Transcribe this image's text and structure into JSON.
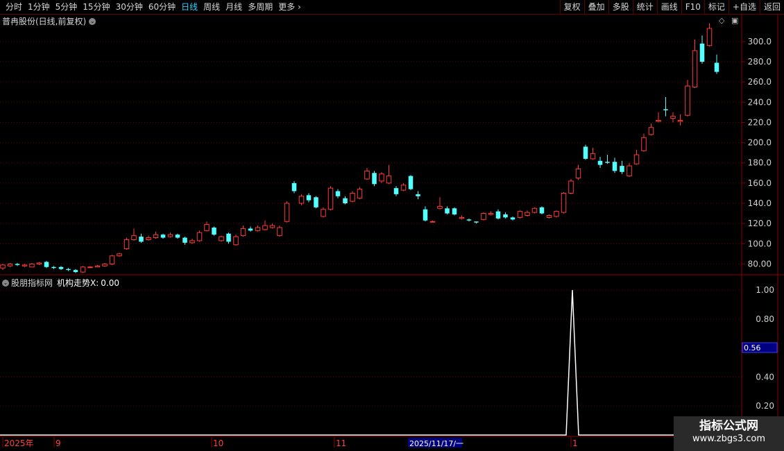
{
  "toolbar": {
    "left_items": [
      "分时",
      "1分钟",
      "5分钟",
      "15分钟",
      "30分钟",
      "60分钟",
      "日线",
      "周线",
      "月线",
      "多周期",
      "更多"
    ],
    "active": "日线",
    "right_items": [
      "复权",
      "叠加",
      "多股",
      "统计",
      "画线",
      "F10",
      "标记",
      "+自选",
      "返回"
    ]
  },
  "chart": {
    "title": "普冉股份(日线,前复权)",
    "price_axis": [
      "300.0",
      "280.0",
      "260.0",
      "240.0",
      "220.0",
      "200.0",
      "180.0",
      "160.0",
      "140.0",
      "120.0",
      "100.0",
      "80.00"
    ],
    "colors": {
      "up": "#ff3b3b",
      "down": "#54ffff",
      "grid": "#6e0000",
      "frame": "#8a0000"
    }
  },
  "indicator": {
    "source": "股朋指标网",
    "name": "机构走势X:",
    "value": "0.00",
    "axis": [
      "1.00",
      "0.80",
      "0.40",
      "0.20"
    ],
    "cursor_value": "0.56"
  },
  "time_axis": {
    "labels": [
      "2025年",
      "9",
      "10",
      "11",
      "1"
    ],
    "cursor_date": "2025/11/17/一"
  },
  "watermark": {
    "line1": "指标公式网",
    "line2": "www.zbgs3.com"
  },
  "chart_data": {
    "type": "candlestick",
    "ylim": [
      70,
      315
    ],
    "indicator_ylim": [
      0,
      1
    ],
    "candles": [
      [
        76,
        79,
        74,
        80
      ],
      [
        78,
        80,
        77,
        81
      ],
      [
        80,
        79,
        78,
        81
      ],
      [
        78,
        79,
        77,
        80
      ],
      [
        77,
        80,
        77,
        81
      ],
      [
        80,
        81,
        79,
        82
      ],
      [
        82,
        77,
        76,
        83
      ],
      [
        77,
        76,
        75,
        78
      ],
      [
        77,
        75,
        74,
        78
      ],
      [
        75,
        74,
        73,
        76
      ],
      [
        74,
        72,
        71,
        75
      ],
      [
        72,
        77,
        71,
        78
      ],
      [
        77,
        77,
        76,
        78
      ],
      [
        77,
        78,
        77,
        79
      ],
      [
        78,
        80,
        77,
        81
      ],
      [
        80,
        88,
        79,
        89
      ],
      [
        88,
        90,
        87,
        91
      ],
      [
        95,
        104,
        94,
        106
      ],
      [
        104,
        108,
        103,
        115
      ],
      [
        107,
        102,
        101,
        110
      ],
      [
        104,
        106,
        103,
        108
      ],
      [
        106,
        109,
        105,
        112
      ],
      [
        109,
        106,
        105,
        110
      ],
      [
        107,
        109,
        106,
        111
      ],
      [
        109,
        106,
        105,
        110
      ],
      [
        106,
        101,
        99,
        107
      ],
      [
        101,
        103,
        100,
        105
      ],
      [
        103,
        111,
        102,
        113
      ],
      [
        113,
        119,
        112,
        122
      ],
      [
        116,
        109,
        108,
        117
      ],
      [
        103,
        107,
        102,
        108
      ],
      [
        110,
        102,
        100,
        111
      ],
      [
        99,
        107,
        98,
        109
      ],
      [
        108,
        115,
        107,
        118
      ],
      [
        115,
        113,
        112,
        117
      ],
      [
        113,
        116,
        112,
        118
      ],
      [
        114,
        118,
        113,
        123
      ],
      [
        116,
        118,
        115,
        120
      ],
      [
        108,
        116,
        107,
        118
      ],
      [
        122,
        140,
        121,
        142
      ],
      [
        160,
        152,
        150,
        162
      ],
      [
        140,
        147,
        138,
        149
      ],
      [
        148,
        143,
        141,
        150
      ],
      [
        146,
        136,
        135,
        147
      ],
      [
        127,
        134,
        126,
        136
      ],
      [
        134,
        155,
        133,
        157
      ],
      [
        152,
        147,
        145,
        154
      ],
      [
        145,
        140,
        139,
        147
      ],
      [
        142,
        150,
        141,
        152
      ],
      [
        145,
        154,
        144,
        156
      ],
      [
        164,
        172,
        163,
        175
      ],
      [
        170,
        159,
        157,
        172
      ],
      [
        162,
        169,
        160,
        171
      ],
      [
        160,
        167,
        159,
        178
      ],
      [
        155,
        149,
        147,
        157
      ],
      [
        153,
        158,
        152,
        160
      ],
      [
        167,
        154,
        153,
        168
      ],
      [
        149,
        147,
        144,
        152
      ],
      [
        134,
        123,
        122,
        137
      ],
      [
        122,
        122,
        121,
        123
      ],
      [
        135,
        137,
        134,
        146
      ],
      [
        135,
        130,
        129,
        137
      ],
      [
        135,
        129,
        128,
        136
      ],
      [
        125,
        126,
        124,
        128
      ],
      [
        124,
        123,
        122,
        125
      ],
      [
        122,
        121,
        120,
        122
      ],
      [
        124,
        130,
        123,
        131
      ],
      [
        129,
        130,
        128,
        132
      ],
      [
        132,
        125,
        124,
        134
      ],
      [
        129,
        126,
        125,
        131
      ],
      [
        126,
        124,
        123,
        127
      ],
      [
        126,
        132,
        125,
        133
      ],
      [
        128,
        131,
        127,
        133
      ],
      [
        131,
        135,
        130,
        136
      ],
      [
        136,
        130,
        129,
        137
      ],
      [
        126,
        128,
        125,
        129
      ],
      [
        127,
        132,
        126,
        133
      ],
      [
        131,
        150,
        130,
        151
      ],
      [
        150,
        162,
        149,
        164
      ],
      [
        165,
        174,
        163,
        178
      ],
      [
        196,
        184,
        183,
        198
      ],
      [
        184,
        189,
        183,
        195
      ],
      [
        182,
        178,
        175,
        186
      ],
      [
        181,
        180,
        179,
        188
      ],
      [
        181,
        172,
        170,
        185
      ],
      [
        177,
        171,
        169,
        182
      ],
      [
        167,
        177,
        166,
        180
      ],
      [
        179,
        188,
        178,
        193
      ],
      [
        192,
        205,
        191,
        209
      ],
      [
        208,
        215,
        207,
        219
      ],
      [
        221,
        222,
        220,
        230
      ],
      [
        233,
        232,
        226,
        245
      ],
      [
        224,
        226,
        220,
        230
      ],
      [
        221,
        222,
        217,
        228
      ],
      [
        227,
        256,
        226,
        262
      ],
      [
        255,
        291,
        254,
        302
      ],
      [
        298,
        280,
        278,
        306
      ],
      [
        296,
        313,
        295,
        318
      ],
      [
        279,
        270,
        268,
        287
      ]
    ],
    "indicator_values": [
      [
        825,
        1.0
      ]
    ]
  }
}
